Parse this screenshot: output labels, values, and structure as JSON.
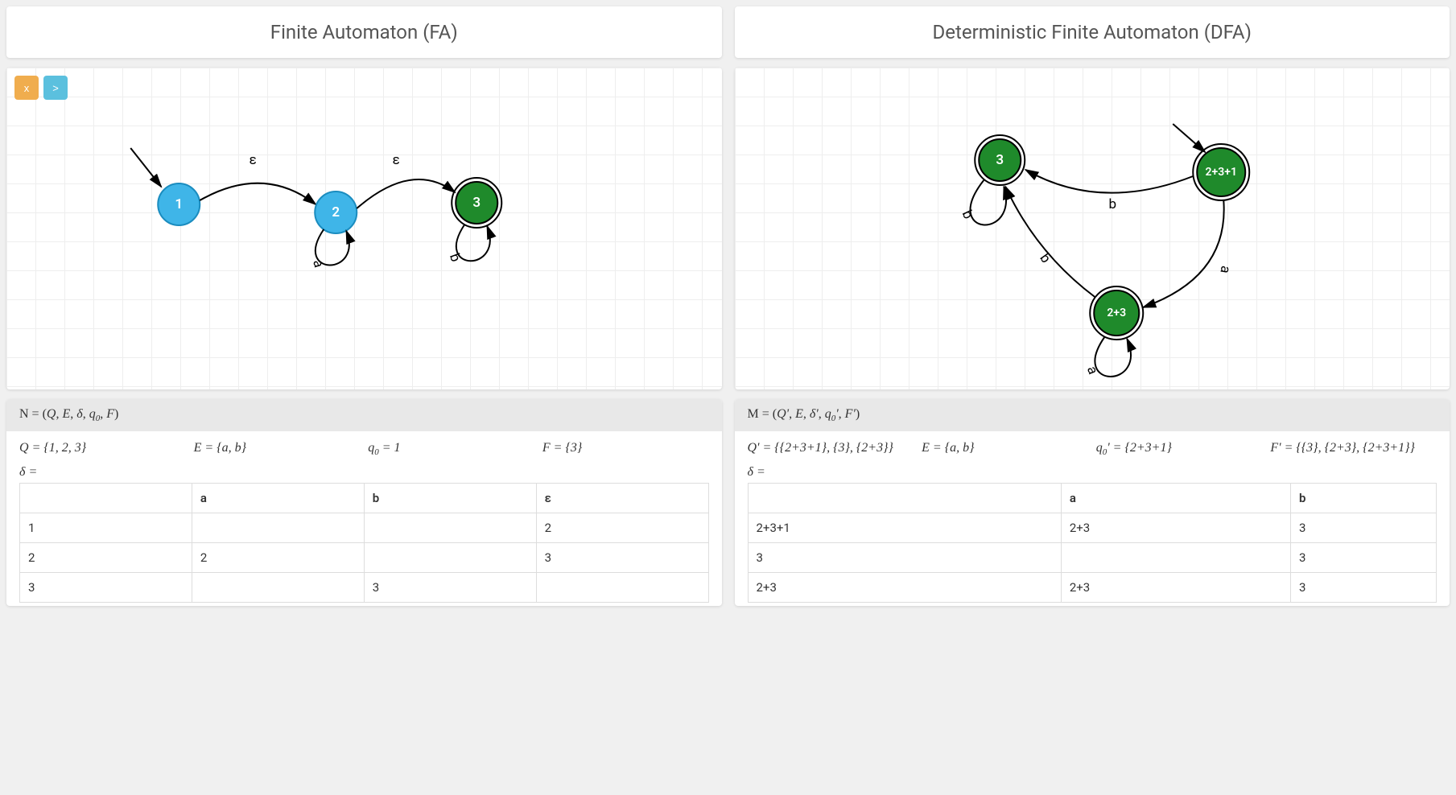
{
  "fa": {
    "title": "Finite Automaton (FA)",
    "toolbar": {
      "del": "x",
      "next": ">"
    },
    "tuple_header": "N = (Q, E, δ, q₀, F)",
    "Q": "Q = {1, 2, 3}",
    "E": "E = {a, b}",
    "q0": "q₀ = 1",
    "F": "F = {3}",
    "delta": "δ =",
    "table": {
      "headers": [
        "",
        "a",
        "b",
        "ε"
      ],
      "rows": [
        [
          "1",
          "",
          "",
          "2"
        ],
        [
          "2",
          "2",
          "",
          "3"
        ],
        [
          "3",
          "",
          "3",
          ""
        ]
      ]
    },
    "states": {
      "s1": "1",
      "s2": "2",
      "s3": "3"
    },
    "edges": {
      "e12": "ε",
      "e23": "ε",
      "loop2": "a",
      "loop3": "b"
    }
  },
  "dfa": {
    "title": "Deterministic Finite Automaton (DFA)",
    "tuple_header": "M = (Q', E, δ', q₀', F')",
    "Q": "Q' = {{2+3+1}, {3}, {2+3}}",
    "E": "E = {a, b}",
    "q0": "q₀' = {2+3+1}",
    "F": "F' = {{3}, {2+3}, {2+3+1}}",
    "delta": "δ =",
    "table": {
      "headers": [
        "",
        "a",
        "b"
      ],
      "rows": [
        [
          "2+3+1",
          "2+3",
          "3"
        ],
        [
          "3",
          "",
          "3"
        ],
        [
          "2+3",
          "2+3",
          "3"
        ]
      ]
    },
    "states": {
      "s3": "3",
      "s231": "2+3+1",
      "s23": "2+3"
    },
    "edges": {
      "e231_3": "b",
      "e231_23": "a",
      "e23_3": "b",
      "loop3": "b",
      "loop23": "a"
    }
  }
}
